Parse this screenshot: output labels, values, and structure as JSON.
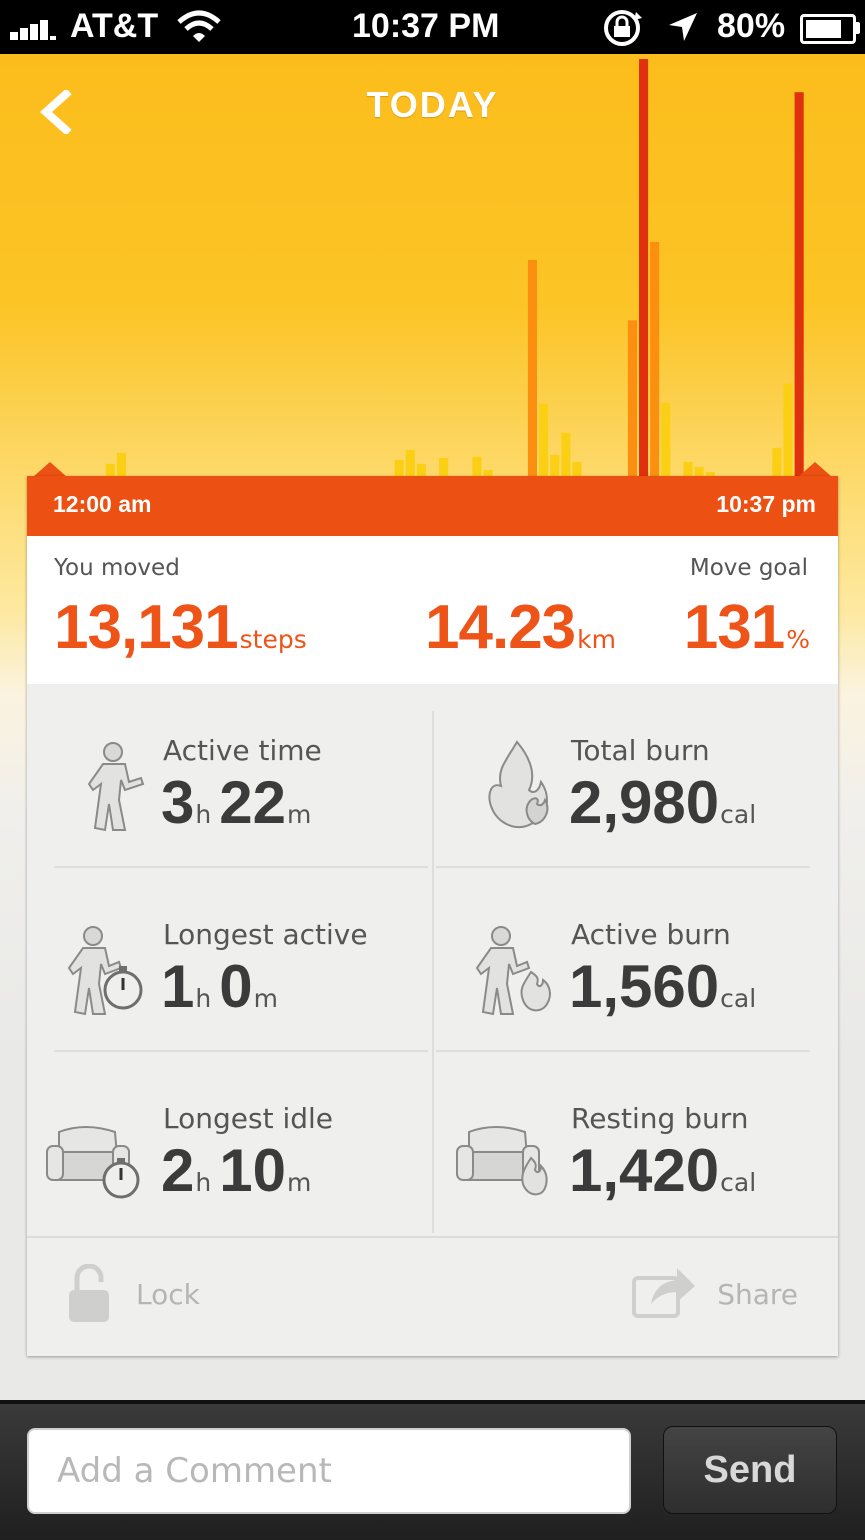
{
  "status_bar": {
    "carrier": "AT&T",
    "time": "10:37 PM",
    "battery_percent": "80%",
    "battery_level": 0.8,
    "icons": [
      "signal-icon",
      "wifi-icon",
      "rotation-lock-icon",
      "location-icon",
      "battery-icon"
    ]
  },
  "header": {
    "title": "TODAY",
    "back_icon": "chevron-left-icon"
  },
  "timeline": {
    "start_label": "12:00 am",
    "end_label": "10:37 pm"
  },
  "summary": {
    "moved_label": "You moved",
    "steps_value": "13,131",
    "steps_unit": "steps",
    "distance_value": "14.23",
    "distance_unit": "km",
    "goal_label": "Move goal",
    "goal_value": "131",
    "goal_unit": "%",
    "goal_fraction": 1.31
  },
  "stats": {
    "active_time": {
      "label": "Active time",
      "hours": "3",
      "h_unit": "h",
      "minutes": "22",
      "m_unit": "m",
      "icon": "runner-icon"
    },
    "total_burn": {
      "label": "Total burn",
      "value": "2,980",
      "unit": "cal",
      "icon": "flame-icon"
    },
    "longest_active": {
      "label": "Longest active",
      "hours": "1",
      "h_unit": "h",
      "minutes": "0",
      "m_unit": "m",
      "icon": "runner-stopwatch-icon"
    },
    "active_burn": {
      "label": "Active burn",
      "value": "1,560",
      "unit": "cal",
      "icon": "runner-flame-icon"
    },
    "longest_idle": {
      "label": "Longest idle",
      "hours": "2",
      "h_unit": "h",
      "minutes": "10",
      "m_unit": "m",
      "icon": "armchair-stopwatch-icon"
    },
    "resting_burn": {
      "label": "Resting burn",
      "value": "1,420",
      "unit": "cal",
      "icon": "armchair-flame-icon"
    }
  },
  "actions": {
    "lock_label": "Lock",
    "share_label": "Share"
  },
  "comment": {
    "placeholder": "Add a Comment",
    "value": "",
    "send_label": "Send"
  },
  "colors": {
    "accent": "#ec5012",
    "highlight_number": "#ee5318",
    "bar_light": "#fbcf14",
    "bar_mid": "#fc8f10",
    "bar_peak": "#e0310f"
  },
  "chart_data": {
    "type": "bar",
    "x_start_label": "12:00 am",
    "x_end_label": "10:37 pm",
    "bar_count": 73,
    "bars": [
      {
        "index": 7,
        "value": 1.2,
        "level": "light"
      },
      {
        "index": 8,
        "value": 2.3,
        "level": "light"
      },
      {
        "index": 33,
        "value": 1.6,
        "level": "light"
      },
      {
        "index": 34,
        "value": 2.6,
        "level": "light"
      },
      {
        "index": 35,
        "value": 1.2,
        "level": "light"
      },
      {
        "index": 37,
        "value": 1.8,
        "level": "light"
      },
      {
        "index": 40,
        "value": 1.9,
        "level": "light"
      },
      {
        "index": 41,
        "value": 0.6,
        "level": "light"
      },
      {
        "index": 45,
        "value": 21.5,
        "level": "mid"
      },
      {
        "index": 46,
        "value": 7.2,
        "level": "light"
      },
      {
        "index": 47,
        "value": 2.1,
        "level": "light"
      },
      {
        "index": 48,
        "value": 4.3,
        "level": "light"
      },
      {
        "index": 49,
        "value": 1.4,
        "level": "light"
      },
      {
        "index": 54,
        "value": 15.5,
        "level": "mid"
      },
      {
        "index": 55,
        "value": 41.5,
        "level": "peak"
      },
      {
        "index": 56,
        "value": 23.3,
        "level": "mid"
      },
      {
        "index": 57,
        "value": 7.3,
        "level": "light"
      },
      {
        "index": 59,
        "value": 1.4,
        "level": "light"
      },
      {
        "index": 60,
        "value": 0.9,
        "level": "light"
      },
      {
        "index": 61,
        "value": 0.4,
        "level": "light"
      },
      {
        "index": 67,
        "value": 2.8,
        "level": "light"
      },
      {
        "index": 68,
        "value": 9.2,
        "level": "light"
      },
      {
        "index": 69,
        "value": 38.2,
        "level": "peak"
      }
    ]
  }
}
